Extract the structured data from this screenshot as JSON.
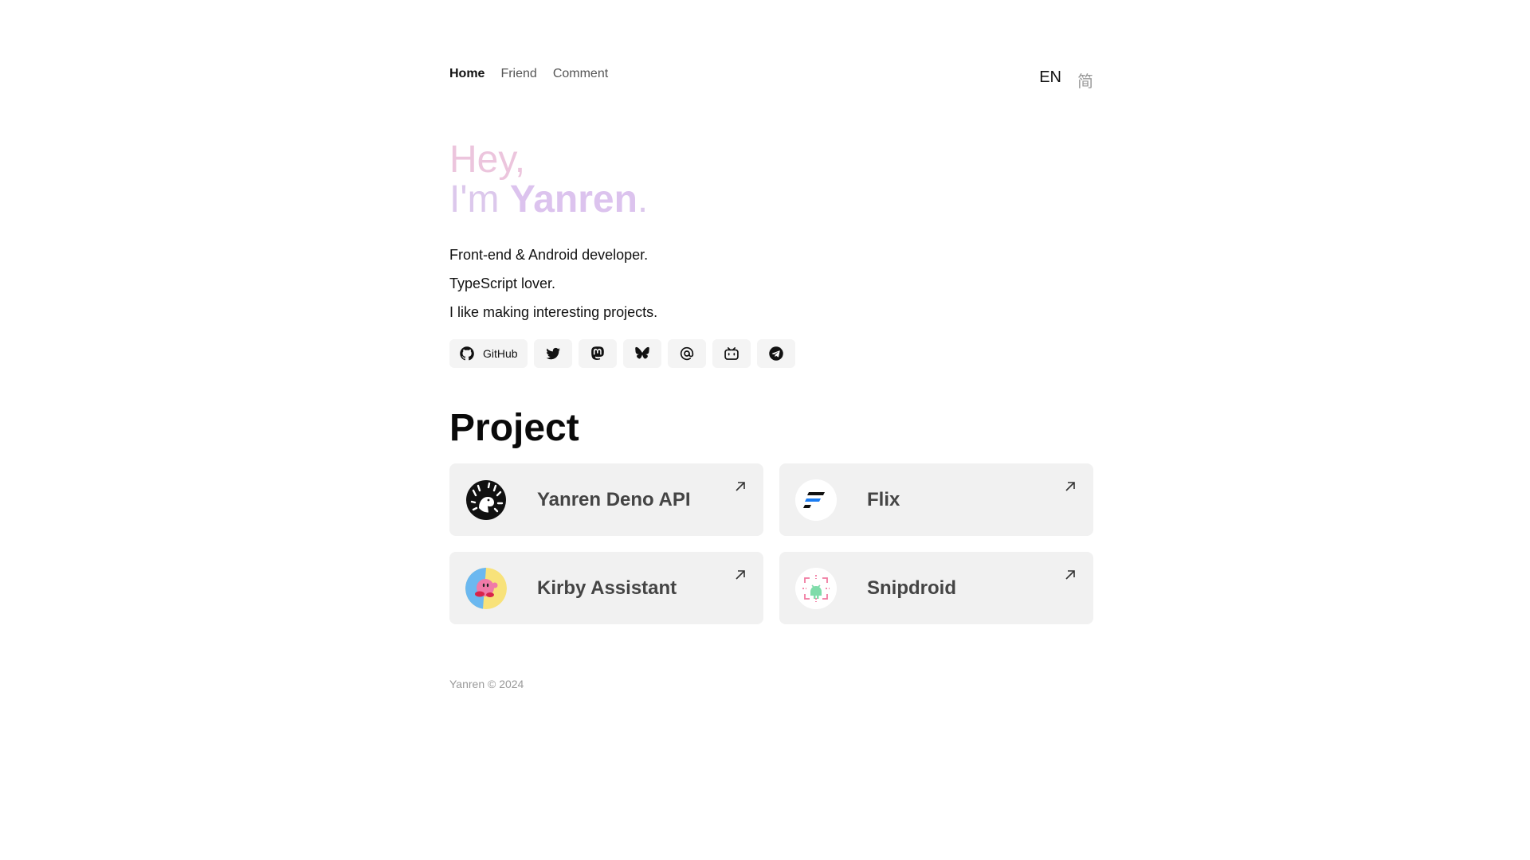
{
  "nav": {
    "items": [
      {
        "label": "Home",
        "active": true
      },
      {
        "label": "Friend",
        "active": false
      },
      {
        "label": "Comment",
        "active": false
      }
    ]
  },
  "lang": {
    "en": "EN",
    "zh": "简"
  },
  "hero": {
    "line1": "Hey,",
    "line2_prefix": "I'm ",
    "name": "Yanren",
    "line2_suffix": "."
  },
  "bio": [
    "Front-end & Android developer.",
    "TypeScript lover.",
    "I like making interesting projects."
  ],
  "socials": {
    "github_label": "GitHub",
    "icons": [
      "github-icon",
      "twitter-icon",
      "mastodon-icon",
      "bluesky-icon",
      "email-at-icon",
      "bilibili-icon",
      "telegram-icon"
    ]
  },
  "project": {
    "heading": "Project",
    "cards": [
      {
        "title": "Yanren Deno API",
        "icon": "deno-icon"
      },
      {
        "title": "Flix",
        "icon": "flix-icon"
      },
      {
        "title": "Kirby Assistant",
        "icon": "kirby-icon"
      },
      {
        "title": "Snipdroid",
        "icon": "snipdroid-icon"
      }
    ]
  },
  "footer": {
    "text": "Yanren © 2024"
  },
  "colors": {
    "hero_line1": "#ecc5dd",
    "hero_line2": "#dcc8ec",
    "card_bg": "#f1f1f1",
    "social_bg": "#f4f4f4"
  }
}
